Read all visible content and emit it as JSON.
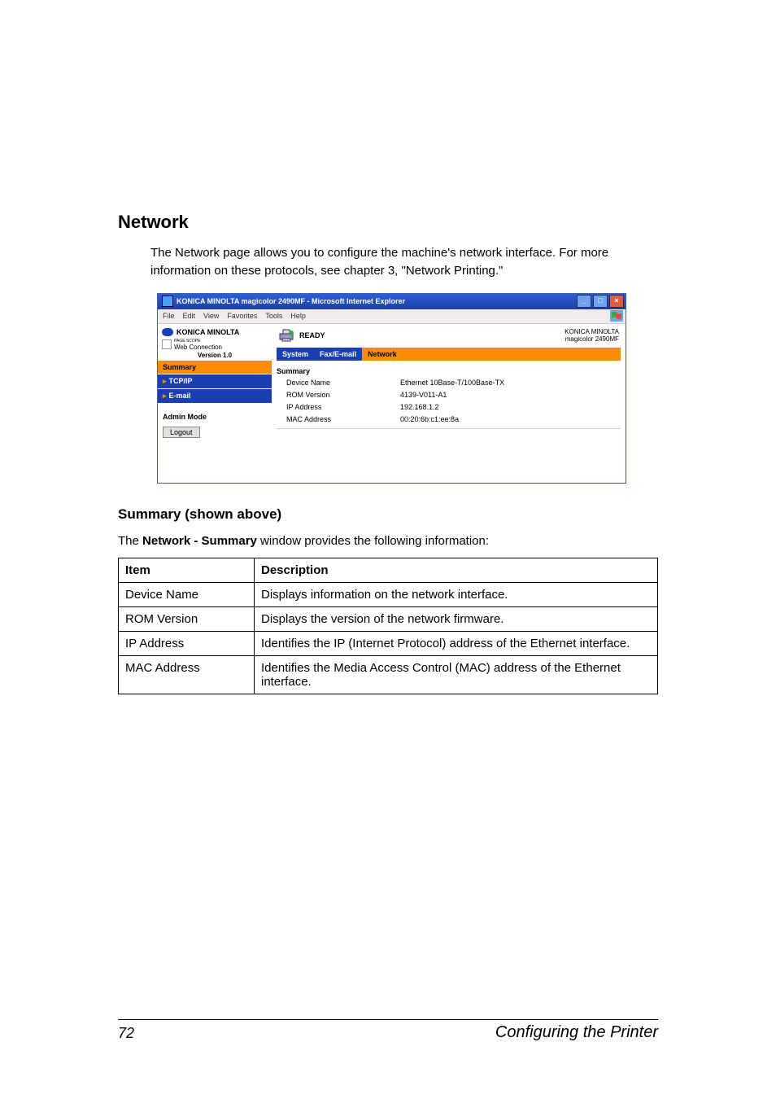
{
  "section_title": "Network",
  "para1": "The Network page allows you to configure the machine's network interface. For more information on these protocols, see chapter 3, \"Network Printing.\"",
  "browser": {
    "title": "KONICA MINOLTA magicolor 2490MF - Microsoft Internet Explorer",
    "menus": [
      "File",
      "Edit",
      "View",
      "Favorites",
      "Tools",
      "Help"
    ],
    "brand": "KONICA MINOLTA",
    "pagescope": "Web Connection",
    "pagescope_prefix": "PAGE SCOPE",
    "version": "Version 1.0",
    "nav_summary": "Summary",
    "nav_tcp": "TCP/IP",
    "nav_email": "E-mail",
    "admin": "Admin Mode",
    "logout": "Logout",
    "status": "READY",
    "device_brand": "KONICA MINOLTA",
    "device_model": "magicolor 2490MF",
    "tab_system": "System",
    "tab_fax": "Fax/E-mail",
    "tab_network": "Network",
    "section_header": "Summary",
    "grid": {
      "l1": "Device Name",
      "v1": "Ethernet 10Base-T/100Base-TX",
      "l2": "ROM Version",
      "v2": "4139-V011-A1",
      "l3": "IP Address",
      "v3": "192.168.1.2",
      "l4": "MAC Address",
      "v4": "00:20:6b:c1:ee:8a"
    }
  },
  "sub_title": "Summary (shown above)",
  "intro_pre": "The ",
  "intro_bold": "Network - Summary",
  "intro_post": " window provides the following information:",
  "table": {
    "h1": "Item",
    "h2": "Description",
    "r1c1": "Device Name",
    "r1c2": "Displays information on the network interface.",
    "r2c1": "ROM Version",
    "r2c2": "Displays the version of the network firmware.",
    "r3c1": "IP Address",
    "r3c2": "Identifies the IP (Internet Protocol) address of the Ether­net interface.",
    "r4c1": "MAC Address",
    "r4c2": "Identifies the Media Access Control (MAC) address of the Ethernet interface."
  },
  "footer": {
    "page": "72",
    "label": "Configuring the Printer"
  }
}
